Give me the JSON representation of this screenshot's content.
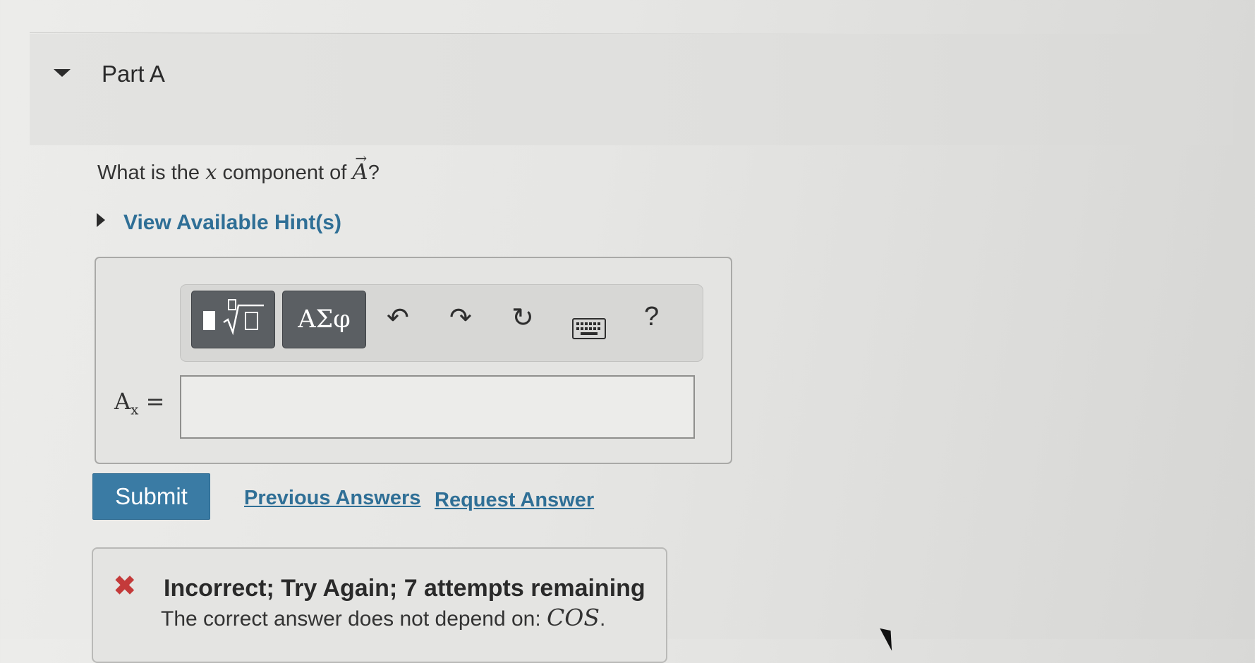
{
  "part": {
    "title": "Part A"
  },
  "question": {
    "prefix": "What is the",
    "variable": "x",
    "middle": "component of",
    "vector": "A",
    "vector_arrow": "→",
    "suffix": "?"
  },
  "hint": {
    "label": "View Available Hint(s)"
  },
  "toolbar": {
    "templates_icon": "templates-radical-icon",
    "symbols_label": "ΑΣφ",
    "undo_icon": "↶",
    "redo_icon": "↷",
    "reset_icon": "↻",
    "keyboard_icon": "keyboard-icon",
    "help_label": "?"
  },
  "answer": {
    "label_main": "A",
    "label_sub": "x",
    "label_eq": "=",
    "value": ""
  },
  "actions": {
    "submit_label": "Submit",
    "previous_answers_label": "Previous Answers",
    "request_answer_label": "Request Answer"
  },
  "feedback": {
    "icon": "✖",
    "title": "Incorrect; Try Again; 7 attempts remaining",
    "detail_prefix": "The correct answer does not depend on:",
    "detail_term": "COS",
    "detail_suffix": ".",
    "status_color": "#c43a3a"
  },
  "colors": {
    "link": "#2f6f96",
    "submit_bg": "#3a7ba4",
    "toolbar_button": "#5b5f63"
  }
}
